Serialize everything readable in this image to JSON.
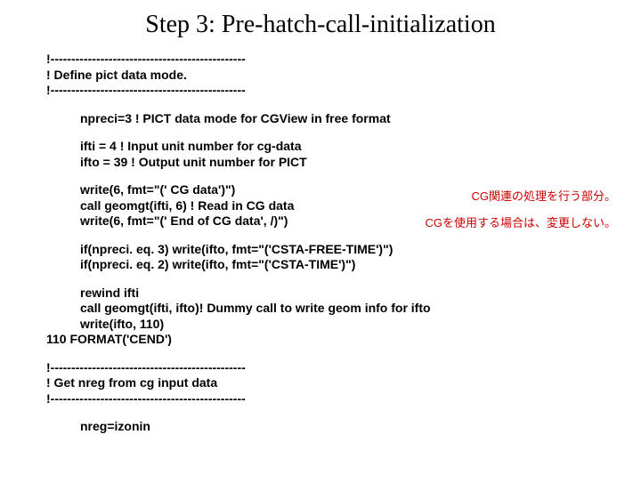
{
  "title": "Step 3: Pre-hatch-call-initialization",
  "sep": "!-----------------------------------------------",
  "comment_pict": "!       Define pict data mode.",
  "line_npreci": "npreci=3     ! PICT data mode for CGView in free format",
  "line_ifti": "ifti = 4    ! Input unit number for cg-data",
  "line_ifto": "ifto = 39    ! Output unit number for PICT",
  "line_write1": "write(6, fmt=\"(' CG data')\")",
  "line_geomgt1": "call geomgt(ifti, 6)  ! Read in CG data",
  "line_write2": "write(6, fmt=\"(' End of CG data', /)\")",
  "line_if3": "if(npreci. eq. 3) write(ifto, fmt=\"('CSTA-FREE-TIME')\")",
  "line_if2": "if(npreci. eq. 2) write(ifto, fmt=\"('CSTA-TIME')\")",
  "line_rewind": "rewind ifti",
  "line_geomgt2": "call geomgt(ifti, ifto)! Dummy call to write geom info for ifto",
  "line_write3": "write(ifto, 110)",
  "line_format": "110   FORMAT('CEND')",
  "comment_nreg": "!       Get nreg from cg input data",
  "line_nreg": "nreg=izonin",
  "annotation1": "CG関連の処理を行う部分。",
  "annotation2": "CGを使用する場合は、変更しない。"
}
